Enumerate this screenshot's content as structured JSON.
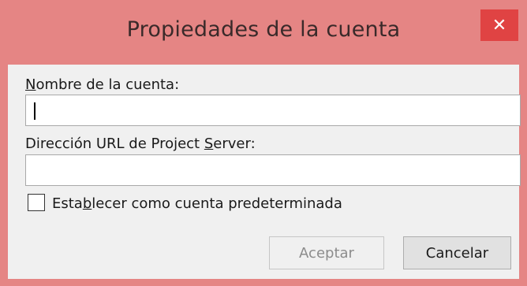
{
  "dialog": {
    "title": "Propiedades de la cuenta",
    "close_glyph": "✕",
    "close_icon": "close-icon"
  },
  "account_name": {
    "label_prefix": "",
    "label_access_key": "N",
    "label_suffix": "ombre de la cuenta:",
    "value": ""
  },
  "server_url": {
    "label_prefix": "Dirección URL de Project ",
    "label_access_key": "S",
    "label_suffix": "erver:",
    "value": ""
  },
  "default_checkbox": {
    "label_prefix": "Esta",
    "label_access_key": "b",
    "label_suffix": "lecer como cuenta predeterminada",
    "checked": false
  },
  "buttons": {
    "ok_label": "Aceptar",
    "ok_enabled": false,
    "cancel_label": "Cancelar"
  },
  "colors": {
    "titlebar": "#e58584",
    "close_button": "#e04343",
    "client_background": "#f0f0f0"
  }
}
